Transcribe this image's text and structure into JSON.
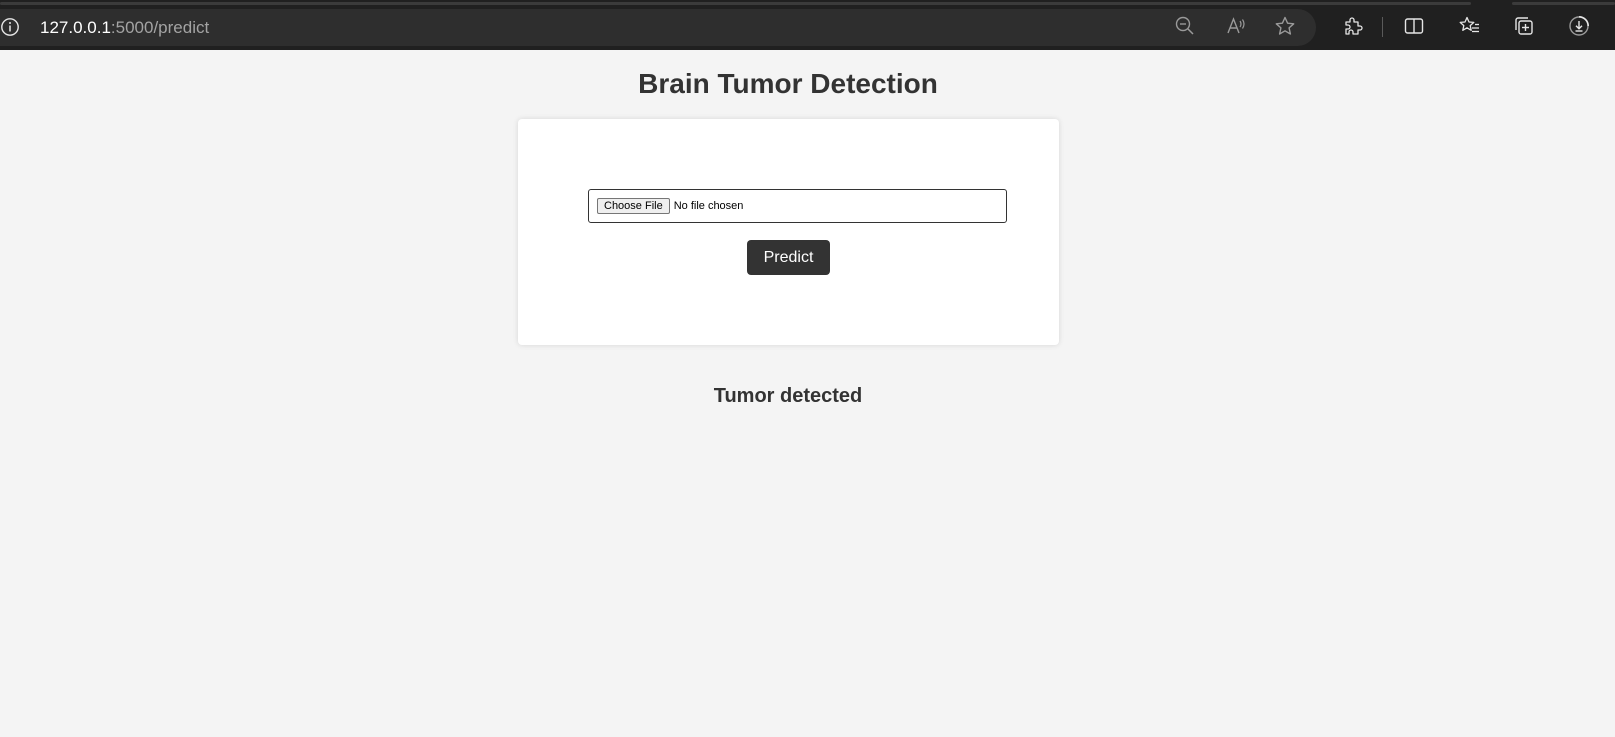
{
  "browser": {
    "url_host": "127.0.0.1",
    "url_rest": ":5000/predict",
    "toolbar_icons": [
      "zoom-out-icon",
      "read-aloud-icon",
      "favorite-star-icon",
      "extensions-icon",
      "split-screen-icon",
      "favorites-icon",
      "collections-icon",
      "downloads-icon"
    ]
  },
  "page": {
    "title": "Brain Tumor Detection",
    "file_button_label": "Choose File",
    "file_status": "No file chosen",
    "predict_label": "Predict",
    "result": "Tumor detected"
  },
  "colors": {
    "page_bg": "#f4f4f4",
    "card_bg": "#ffffff",
    "button_bg": "#333333",
    "text": "#333333",
    "chrome_bg": "#202020"
  }
}
